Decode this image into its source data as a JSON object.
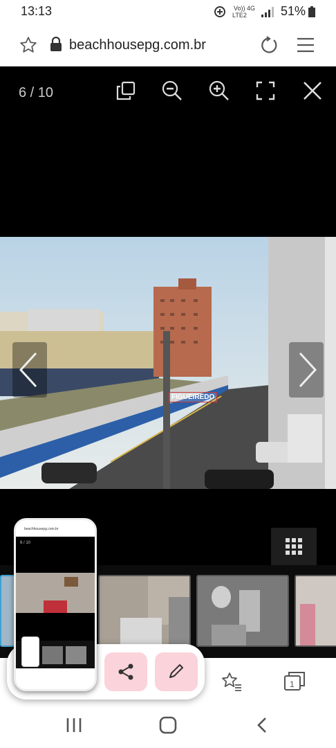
{
  "status_bar": {
    "time": "13:13",
    "network_line1": "Vo)) 4G",
    "network_line2": "LTE2",
    "battery": "51%"
  },
  "browser": {
    "url": "beachhousepg.com.br"
  },
  "viewer": {
    "counter": "6 / 10",
    "watermark": "FIGUEIREDO"
  },
  "mini_screenshot": {
    "url": "beachhousepg.com.br",
    "counter": "6 / 10"
  },
  "colors": {
    "accent_pink": "#fbd3da",
    "viewer_bg": "#000000"
  }
}
